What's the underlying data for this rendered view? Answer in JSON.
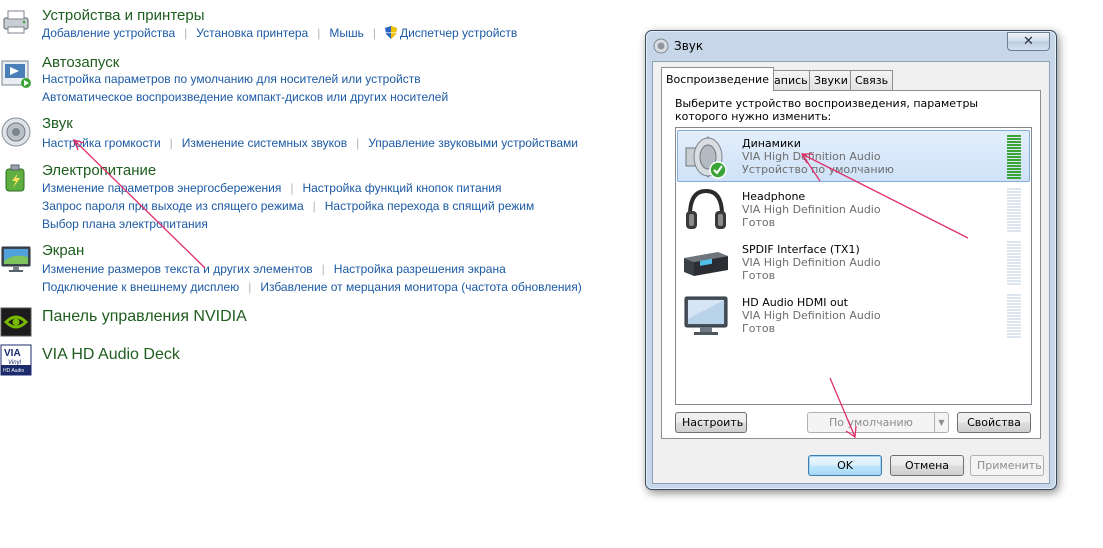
{
  "control_panel": {
    "devices_printers": {
      "title": "Устройства и принтеры",
      "links": [
        "Добавление устройства",
        "Установка принтера",
        "Мышь",
        "Диспетчер устройств"
      ]
    },
    "autoplay": {
      "title": "Автозапуск",
      "links_row1": [
        "Настройка параметров по умолчанию для носителей или устройств"
      ],
      "links_row2": [
        "Автоматическое воспроизведение компакт-дисков или других носителей"
      ]
    },
    "sound": {
      "title": "Звук",
      "links": [
        "Настройка громкости",
        "Изменение системных звуков",
        "Управление звуковыми устройствами"
      ]
    },
    "power": {
      "title": "Электропитание",
      "links_row1": [
        "Изменение параметров энергосбережения",
        "Настройка функций кнопок питания"
      ],
      "links_row2": [
        "Запрос пароля при выходе из спящего режима",
        "Настройка перехода в спящий режим"
      ],
      "links_row3": [
        "Выбор плана электропитания"
      ]
    },
    "display": {
      "title": "Экран",
      "links_row1": [
        "Изменение размеров текста и других элементов",
        "Настройка разрешения экрана"
      ],
      "links_row2": [
        "Подключение к внешнему дисплею",
        "Избавление от мерцания монитора (частота обновления)"
      ]
    },
    "nvidia": {
      "title": "Панель управления NVIDIA"
    },
    "via": {
      "title": "VIA HD Audio Deck",
      "icon_text_1": "VIA",
      "icon_text_2": "Vinyl",
      "icon_text_3": "HD Audio"
    }
  },
  "dialog": {
    "title": "Звук",
    "close_glyph": "✕",
    "tabs": [
      "Воспроизведение",
      "Запись",
      "Звуки",
      "Связь"
    ],
    "instruction": "Выберите устройство воспроизведения, параметры которого нужно изменить:",
    "devices": [
      {
        "name": "Динамики",
        "driver": "VIA High Definition Audio",
        "status": "Устройство по умолчанию",
        "icon": "speaker-icon",
        "level": 1.0
      },
      {
        "name": "Headphone",
        "driver": "VIA High Definition Audio",
        "status": "Готов",
        "icon": "headphone-icon",
        "level": 0
      },
      {
        "name": "SPDIF Interface (TX1)",
        "driver": "VIA High Definition Audio",
        "status": "Готов",
        "icon": "spdif-receiver-icon",
        "level": 0
      },
      {
        "name": "HD Audio HDMI out",
        "driver": "VIA High Definition Audio",
        "status": "Готов",
        "icon": "monitor-icon",
        "level": 0
      }
    ],
    "configure_label": "Настроить",
    "default_label": "По умолчанию",
    "properties_label": "Свойства",
    "ok_label": "OK",
    "cancel_label": "Отмена",
    "apply_label": "Применить"
  },
  "colors": {
    "category_title": "#1e5d1e",
    "link": "#1c5aa4",
    "annotation_arrow": "#e0306a",
    "meter_active": "#3aa536"
  }
}
